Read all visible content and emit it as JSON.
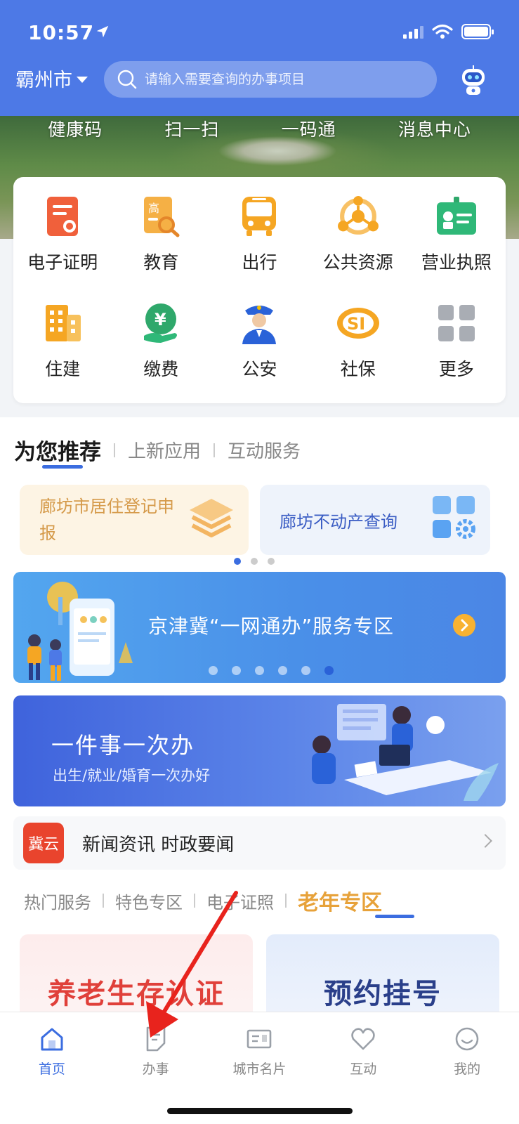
{
  "status_bar": {
    "time": "10:57"
  },
  "header": {
    "city": "霸州市",
    "search_placeholder": "请输入需要查询的办事项目"
  },
  "quick_links": [
    "健康码",
    "扫一扫",
    "一码通",
    "消息中心"
  ],
  "services": [
    {
      "label": "电子证明",
      "icon": "certificate-icon"
    },
    {
      "label": "教育",
      "icon": "education-icon"
    },
    {
      "label": "出行",
      "icon": "bus-icon"
    },
    {
      "label": "公共资源",
      "icon": "public-resource-icon"
    },
    {
      "label": "营业执照",
      "icon": "business-license-icon"
    },
    {
      "label": "住建",
      "icon": "building-icon"
    },
    {
      "label": "缴费",
      "icon": "payment-icon"
    },
    {
      "label": "公安",
      "icon": "police-icon"
    },
    {
      "label": "社保",
      "icon": "social-security-icon"
    },
    {
      "label": "更多",
      "icon": "more-grid-icon"
    }
  ],
  "recommend_tabs": [
    "为您推荐",
    "上新应用",
    "互动服务"
  ],
  "recommend_cards": [
    {
      "text": "廊坊市居住登记申报"
    },
    {
      "text": "廊坊不动产查询"
    }
  ],
  "banner_jjj": {
    "title": "京津冀“一网通办”服务专区"
  },
  "banner_one_thing": {
    "title": "一件事一次办",
    "subtitle": "出生/就业/婚育一次办好"
  },
  "news": {
    "logo": "冀云",
    "text": "新闻资讯 时政要闻"
  },
  "zone_tabs": [
    "热门服务",
    "特色专区",
    "电子证照",
    "老年专区"
  ],
  "zone_cards": [
    "养老生存认证",
    "预约挂号"
  ],
  "bottom_nav": [
    "首页",
    "办事",
    "城市名片",
    "互动",
    "我的"
  ],
  "colors": {
    "primary": "#4d79e6",
    "accent_orange": "#f5a623",
    "active_blue": "#3b6de0",
    "annotation_red": "#e8231d"
  }
}
